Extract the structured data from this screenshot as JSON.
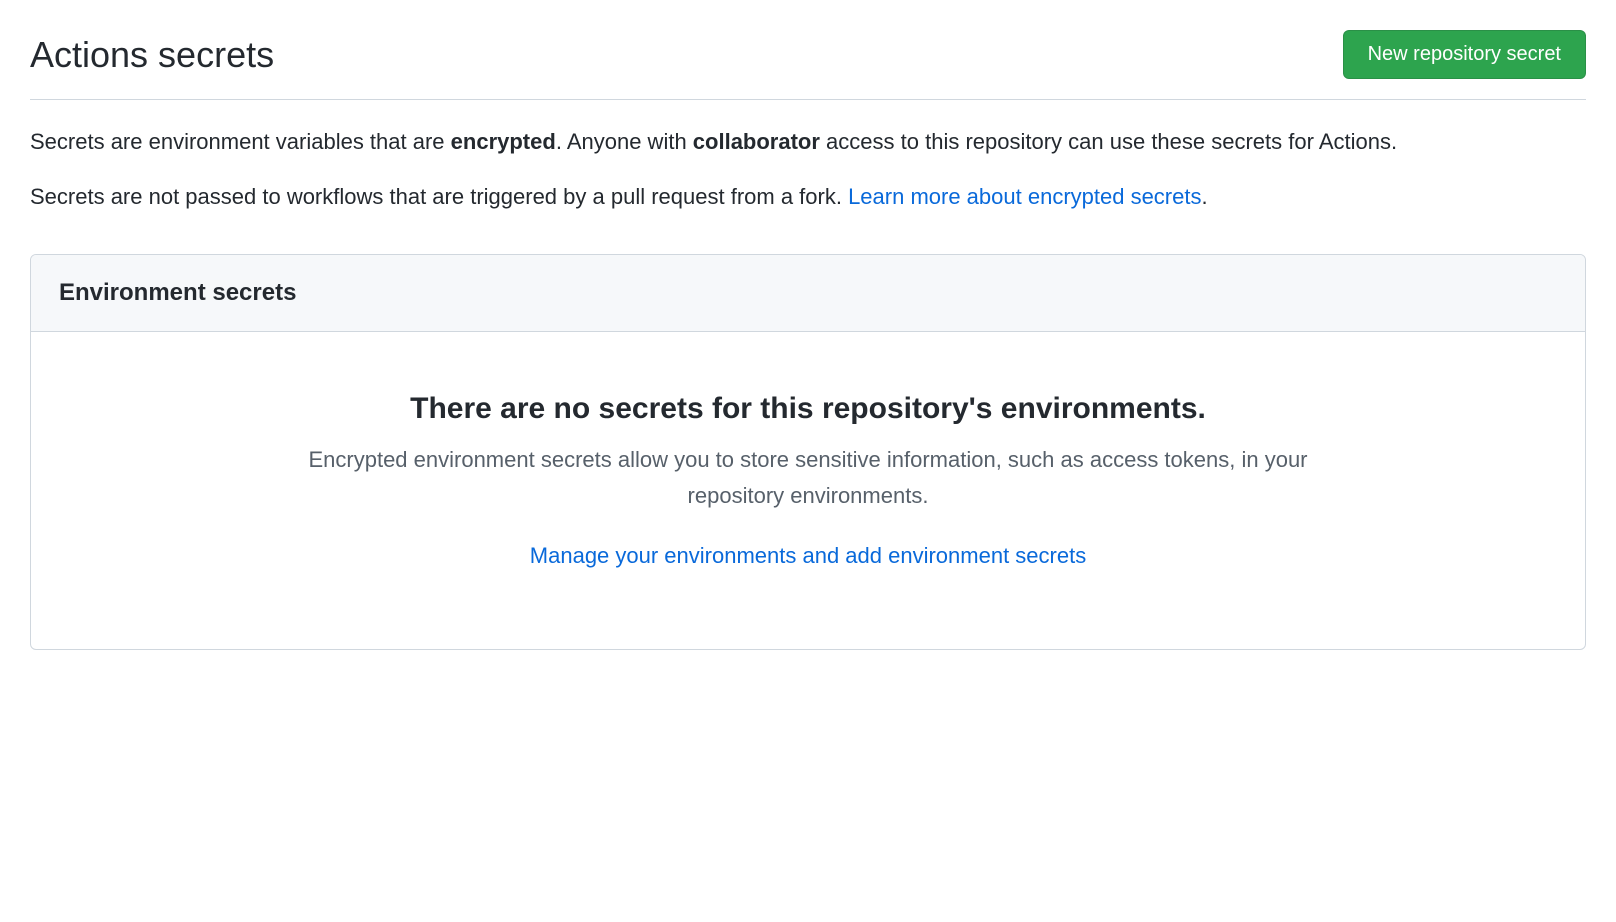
{
  "header": {
    "title": "Actions secrets",
    "new_button_label": "New repository secret"
  },
  "description": {
    "p1_prefix": "Secrets are environment variables that are ",
    "p1_bold1": "encrypted",
    "p1_middle": ". Anyone with ",
    "p1_bold2": "collaborator",
    "p1_suffix": " access to this repository can use these secrets for Actions.",
    "p2_prefix": "Secrets are not passed to workflows that are triggered by a pull request from a fork. ",
    "p2_link": "Learn more about encrypted secrets",
    "p2_suffix": "."
  },
  "panel": {
    "header_title": "Environment secrets",
    "empty_title": "There are no secrets for this repository's environments.",
    "empty_body": "Encrypted environment secrets allow you to store sensitive information, such as access tokens, in your repository environments.",
    "manage_link": "Manage your environments and add environment secrets"
  }
}
